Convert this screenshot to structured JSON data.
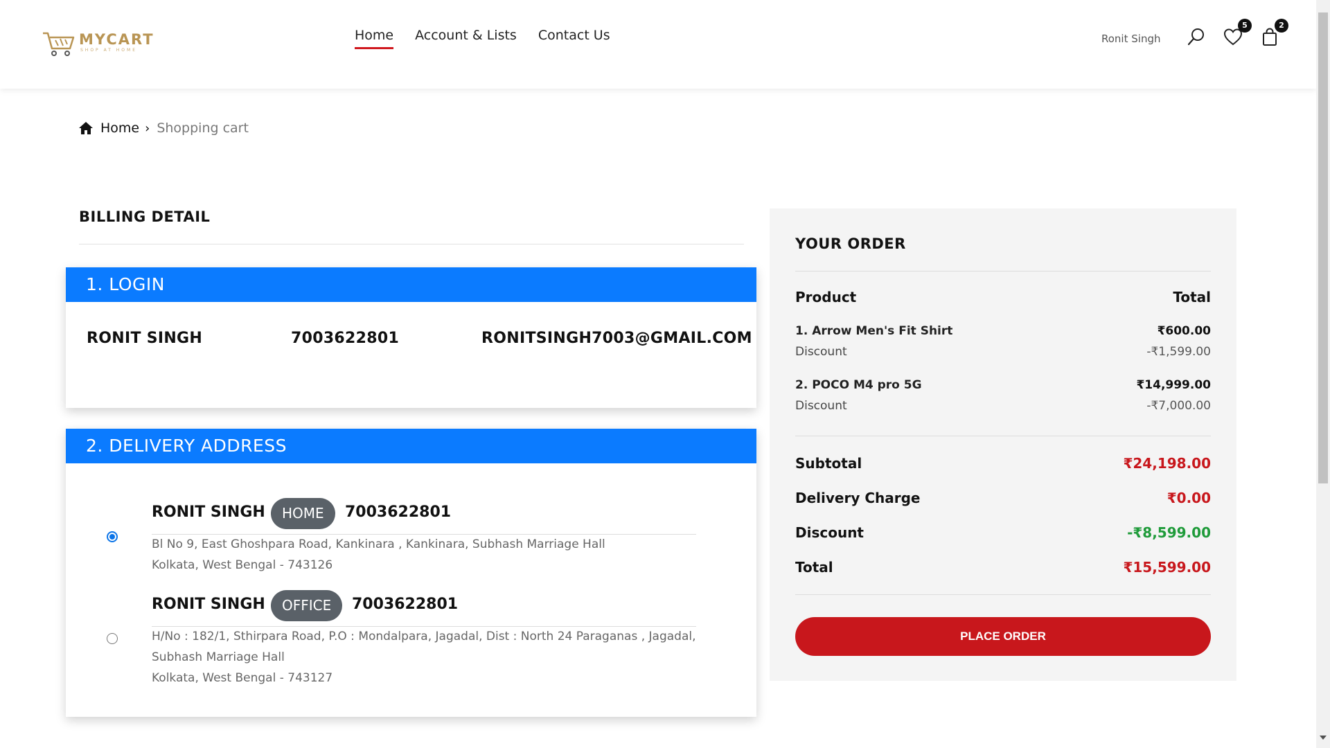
{
  "brand": {
    "name": "MYCART",
    "tagline": "SHOP AT HOME",
    "accent": "#b99554"
  },
  "nav": [
    {
      "label": "Home",
      "active": true
    },
    {
      "label": "Account & Lists",
      "active": false
    },
    {
      "label": "Contact Us",
      "active": false
    }
  ],
  "header": {
    "user_name": "Ronit Singh",
    "wishlist_count": "5",
    "cart_count": "2",
    "icons": [
      "search-icon",
      "heart-icon",
      "shopping-bag-icon"
    ]
  },
  "breadcrumb": {
    "home": "Home",
    "current": "Shopping cart"
  },
  "billing": {
    "title": "BILLING DETAIL",
    "login": {
      "heading": "1. LOGIN",
      "name": "RONIT SINGH",
      "phone": "7003622801",
      "email": "RONITSINGH7003@GMAIL.COM"
    },
    "delivery": {
      "heading": "2. DELIVERY ADDRESS",
      "addresses": [
        {
          "name": "RONIT SINGH",
          "tag": "HOME",
          "phone": "7003622801",
          "line1": "Bl No 9, East Ghoshpara Road, Kankinara , Kankinara, Subhash Marriage Hall",
          "line2": "Kolkata, West Bengal - 743126",
          "selected": true
        },
        {
          "name": "RONIT SINGH",
          "tag": "OFFICE",
          "phone": "7003622801",
          "line1": "H/No : 182/1, Sthirpara Road, P.O : Mondalpara, Jagadal, Dist : North 24 Paraganas , Jagadal,",
          "line2": "Subhash Marriage Hall",
          "line3": "Kolkata, West Bengal - 743127",
          "selected": false
        }
      ]
    }
  },
  "order": {
    "title": "YOUR ORDER",
    "col_product": "Product",
    "col_total": "Total",
    "items": [
      {
        "name": "1. Arrow Men's Fit Shirt",
        "price": "₹600.00",
        "discount_label": "Discount",
        "discount": "-₹1,599.00"
      },
      {
        "name": "2. POCO M4 pro 5G",
        "price": "₹14,999.00",
        "discount_label": "Discount",
        "discount": "-₹7,000.00"
      }
    ],
    "subtotal_label": "Subtotal",
    "subtotal": "₹24,198.00",
    "delivery_label": "Delivery Charge",
    "delivery": "₹0.00",
    "discount_label": "Discount",
    "discount": "-₹8,599.00",
    "total_label": "Total",
    "total": "₹15,599.00",
    "place_order": "PLACE ORDER"
  },
  "colors": {
    "primary_blue": "#0b7bff",
    "brand_red": "#c8171c",
    "discount_green": "#1f9b3a",
    "tag_gray": "#5a6168"
  }
}
